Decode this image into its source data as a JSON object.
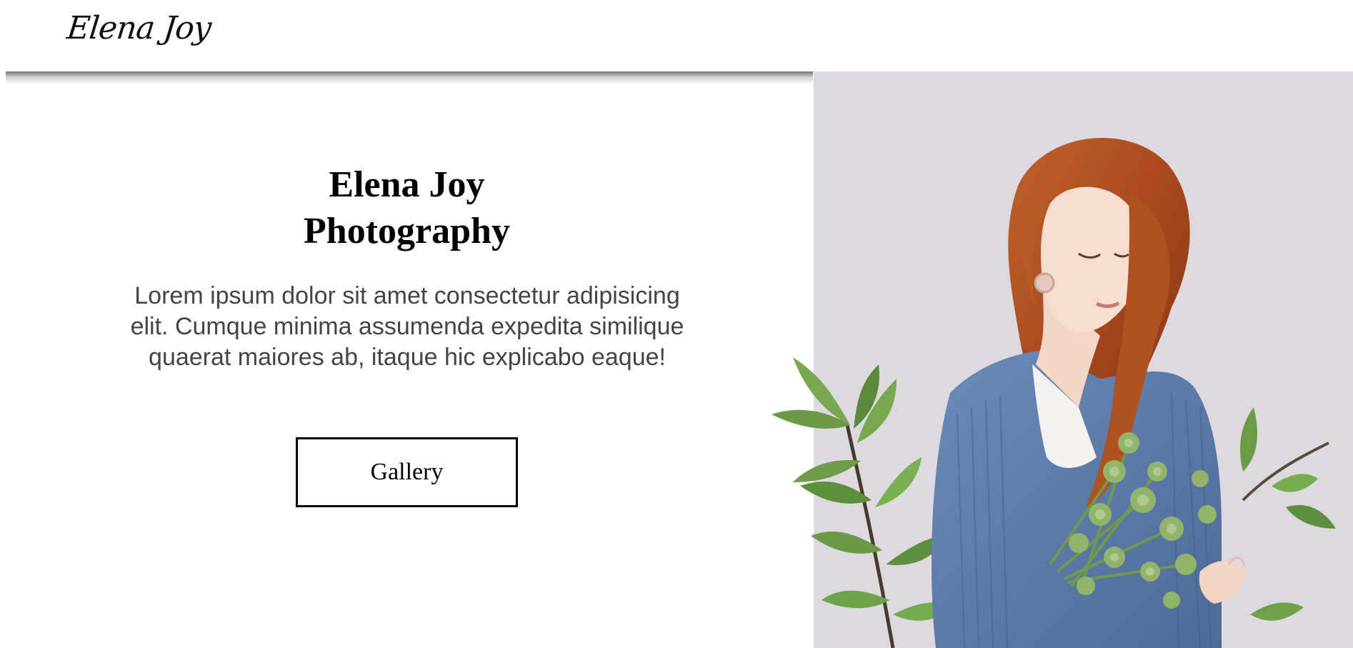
{
  "header": {
    "logo_text": "Elena Joy"
  },
  "hero": {
    "title_line1": "Elena Joy",
    "title_line2": "Photography",
    "description": "Lorem ipsum dolor sit amet consectetur adipisicing elit. Cumque minima assumenda expedita similique quaerat maiores ab, itaque hic explicabo eaque!",
    "button_label": "Gallery"
  },
  "colors": {
    "background": "#ffffff",
    "text": "#000000",
    "body_text": "#444444",
    "photo_background": "#dddadf"
  }
}
